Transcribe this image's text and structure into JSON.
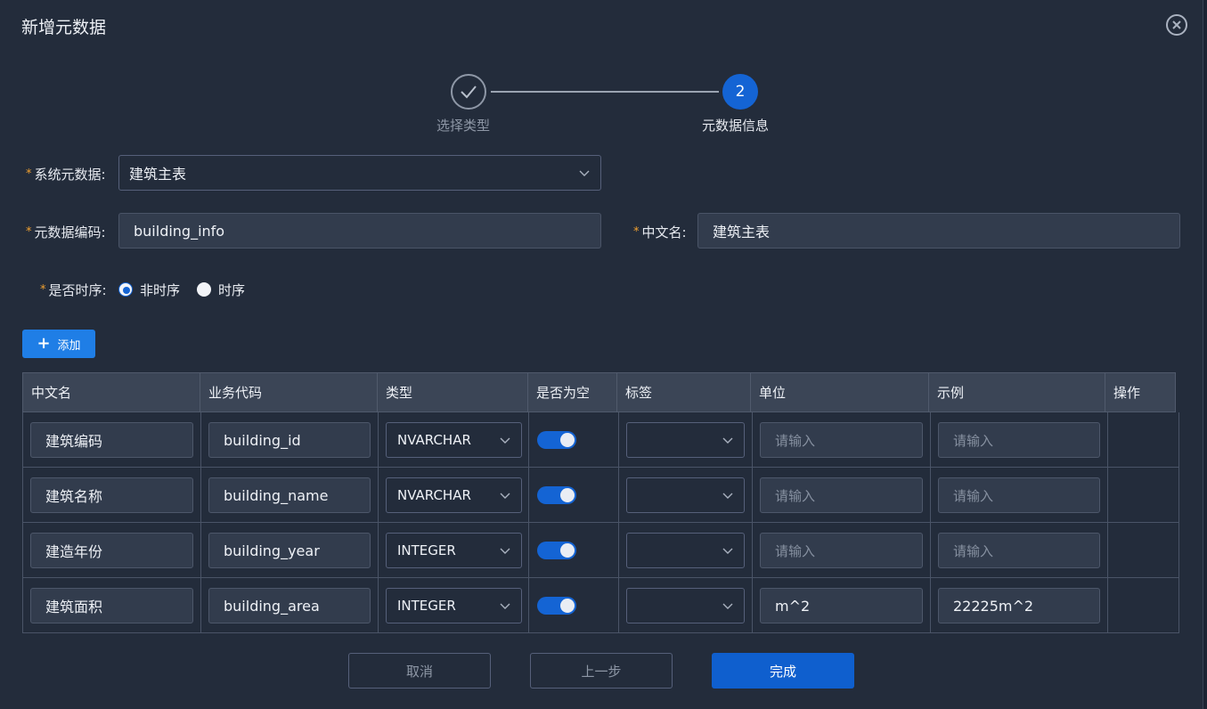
{
  "dialog": {
    "title": "新增元数据"
  },
  "steps": [
    {
      "label": "选择类型",
      "state": "done"
    },
    {
      "label": "元数据信息",
      "number": "2",
      "state": "active"
    }
  ],
  "form": {
    "system_meta": {
      "label": "系统元数据:",
      "value": "建筑主表"
    },
    "meta_code": {
      "label": "元数据编码:",
      "value": "building_info"
    },
    "cn_name": {
      "label": "中文名:",
      "value": "建筑主表"
    },
    "timeseries": {
      "label": "是否时序:",
      "options": [
        "非时序",
        "时序"
      ],
      "selected": "非时序"
    },
    "required_mark": "*"
  },
  "add_button": {
    "label": "添加"
  },
  "table": {
    "columns": [
      "中文名",
      "业务代码",
      "类型",
      "是否为空",
      "标签",
      "单位",
      "示例",
      "操作"
    ],
    "placeholder": "请输入",
    "rows": [
      {
        "name": "建筑编码",
        "code": "building_id",
        "type": "NVARCHAR",
        "nullable": true,
        "tag": "",
        "unit": "",
        "example": ""
      },
      {
        "name": "建筑名称",
        "code": "building_name",
        "type": "NVARCHAR",
        "nullable": true,
        "tag": "",
        "unit": "",
        "example": ""
      },
      {
        "name": "建造年份",
        "code": "building_year",
        "type": "INTEGER",
        "nullable": true,
        "tag": "",
        "unit": "",
        "example": ""
      },
      {
        "name": "建筑面积",
        "code": "building_area",
        "type": "INTEGER",
        "nullable": true,
        "tag": "",
        "unit": "m^2",
        "example": "22225m^2"
      }
    ]
  },
  "footer": {
    "cancel": "取消",
    "prev": "上一步",
    "finish": "完成"
  },
  "colors": {
    "primary": "#1464d4",
    "accent_button": "#1f7ee6",
    "required": "#f0a030",
    "background": "#232c3b"
  }
}
